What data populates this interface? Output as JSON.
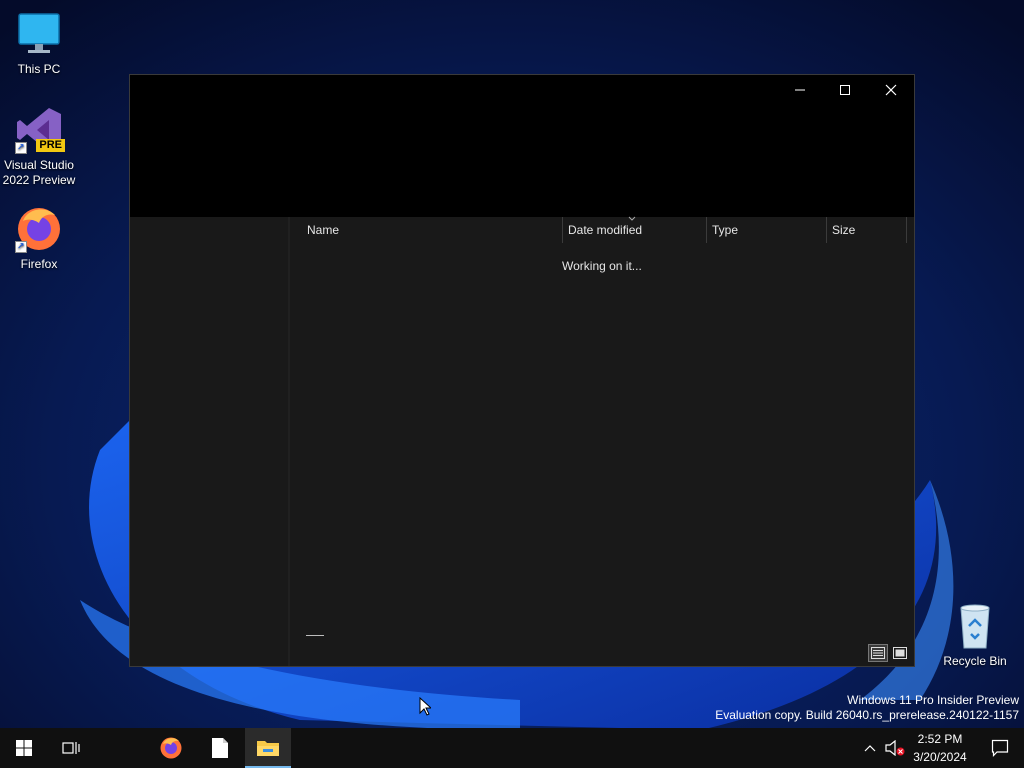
{
  "desktop": {
    "icons": [
      {
        "label": "This PC"
      },
      {
        "label": "Visual Studio 2022 Preview",
        "badge": "PRE"
      },
      {
        "label": "Firefox"
      },
      {
        "label": "Recycle Bin"
      }
    ]
  },
  "explorer": {
    "columns": [
      {
        "label": "Name"
      },
      {
        "label": "Date modified"
      },
      {
        "label": "Type"
      },
      {
        "label": "Size"
      }
    ],
    "status_message": "Working on it..."
  },
  "watermark": {
    "line1": "Windows 11 Pro Insider Preview",
    "line2": "Evaluation copy. Build 26040.rs_prerelease.240122-1157"
  },
  "taskbar": {
    "time": "2:52 PM",
    "date": "3/20/2024"
  },
  "colors": {
    "accent": "#76b9ed",
    "window_bg": "#191919",
    "titlebar_bg": "#000000"
  }
}
